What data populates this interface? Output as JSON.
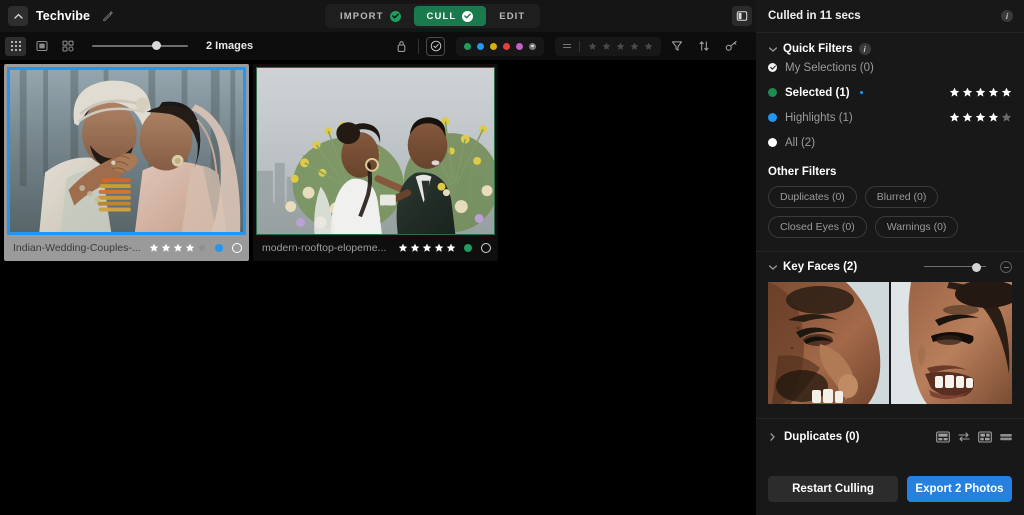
{
  "header": {
    "brand": "Techvibe",
    "caret_icon": "chevron-up-icon",
    "edit_icon": "edit-pencil-icon",
    "panel_toggle_icon": "right-panel-toggle-icon",
    "modes": [
      {
        "label": "IMPORT",
        "active": false,
        "check_icon": "check-circle-icon"
      },
      {
        "label": "CULL",
        "active": true,
        "check_icon": "check-circle-icon"
      },
      {
        "label": "EDIT",
        "active": false,
        "check_icon": ""
      }
    ]
  },
  "toolbar": {
    "views": [
      {
        "name": "grid-view",
        "icon": "grid-dots-icon",
        "active": true
      },
      {
        "name": "single-view",
        "icon": "single-frame-icon",
        "active": false
      },
      {
        "name": "compare-view",
        "icon": "compare-grid-icon",
        "active": false
      }
    ],
    "zoom_slider": {
      "value": 62
    },
    "image_count": "2 Images",
    "lock_icon": "lock-icon",
    "check_circle_icon": "check-circle-outline-icon",
    "colors": [
      "#1f9d5e",
      "#2196f3",
      "#d4b106",
      "#e04040",
      "#c060c8",
      "#7a7a7a"
    ],
    "star_filter": {
      "equals_icon": "equals-icon",
      "stars": 5,
      "filled": 0
    },
    "filter_icon": "funnel-icon",
    "sort_icon": "sort-arrows-icon",
    "key_icon": "key-icon"
  },
  "photos": [
    {
      "name": "Indian-Wedding-Couples-...",
      "stars": 4,
      "max_stars": 5,
      "dot_color": "#2196f3",
      "selected": true,
      "border_color": "#2196f3"
    },
    {
      "name": "modern-rooftop-elopeme...",
      "stars": 5,
      "max_stars": 5,
      "dot_color": "#1f9d5e",
      "selected": false,
      "border_color": "#2f6b46"
    }
  ],
  "right_panel": {
    "status": "Culled in 11 secs",
    "status_info_icon": "info-icon",
    "quick_filters": {
      "title": "Quick Filters",
      "info_icon": "info-icon",
      "twist_icon": "chevron-down-icon",
      "rows": [
        {
          "label": "My Selections (0)",
          "bullet": "#f0f0f0",
          "bullet_type": "check",
          "stars": 0,
          "selected": false,
          "has_dot": false
        },
        {
          "label": "Selected (1)",
          "bullet": "#1f8a52",
          "bullet_type": "solid",
          "stars": 5,
          "selected": true,
          "has_dot": true
        },
        {
          "label": "Highlights (1)",
          "bullet": "#2196f3",
          "bullet_type": "solid",
          "stars": 4,
          "selected": false,
          "has_dot": false
        },
        {
          "label": "All (2)",
          "bullet": "#ffffff",
          "bullet_type": "solid",
          "stars": 0,
          "selected": false,
          "has_dot": false
        }
      ]
    },
    "other_filters": {
      "title": "Other Filters",
      "chips": [
        "Duplicates (0)",
        "Blurred (0)",
        "Closed Eyes (0)",
        "Warnings (0)"
      ]
    },
    "key_faces": {
      "title": "Key Faces (2)",
      "twist_icon": "chevron-down-icon",
      "slider_value": 78,
      "circle_icon": "minus-circle-icon",
      "resize_icon": "resize-vertical-icon"
    },
    "duplicates": {
      "title": "Duplicates (0)",
      "twist_icon": "chevron-right-icon",
      "icons": [
        "layout-two-up-icon",
        "swap-icon",
        "layout-grid-icon",
        "layout-stack-icon"
      ]
    },
    "footer": {
      "restart_label": "Restart Culling",
      "export_label": "Export 2 Photos",
      "export_color": "#2580e0"
    }
  }
}
